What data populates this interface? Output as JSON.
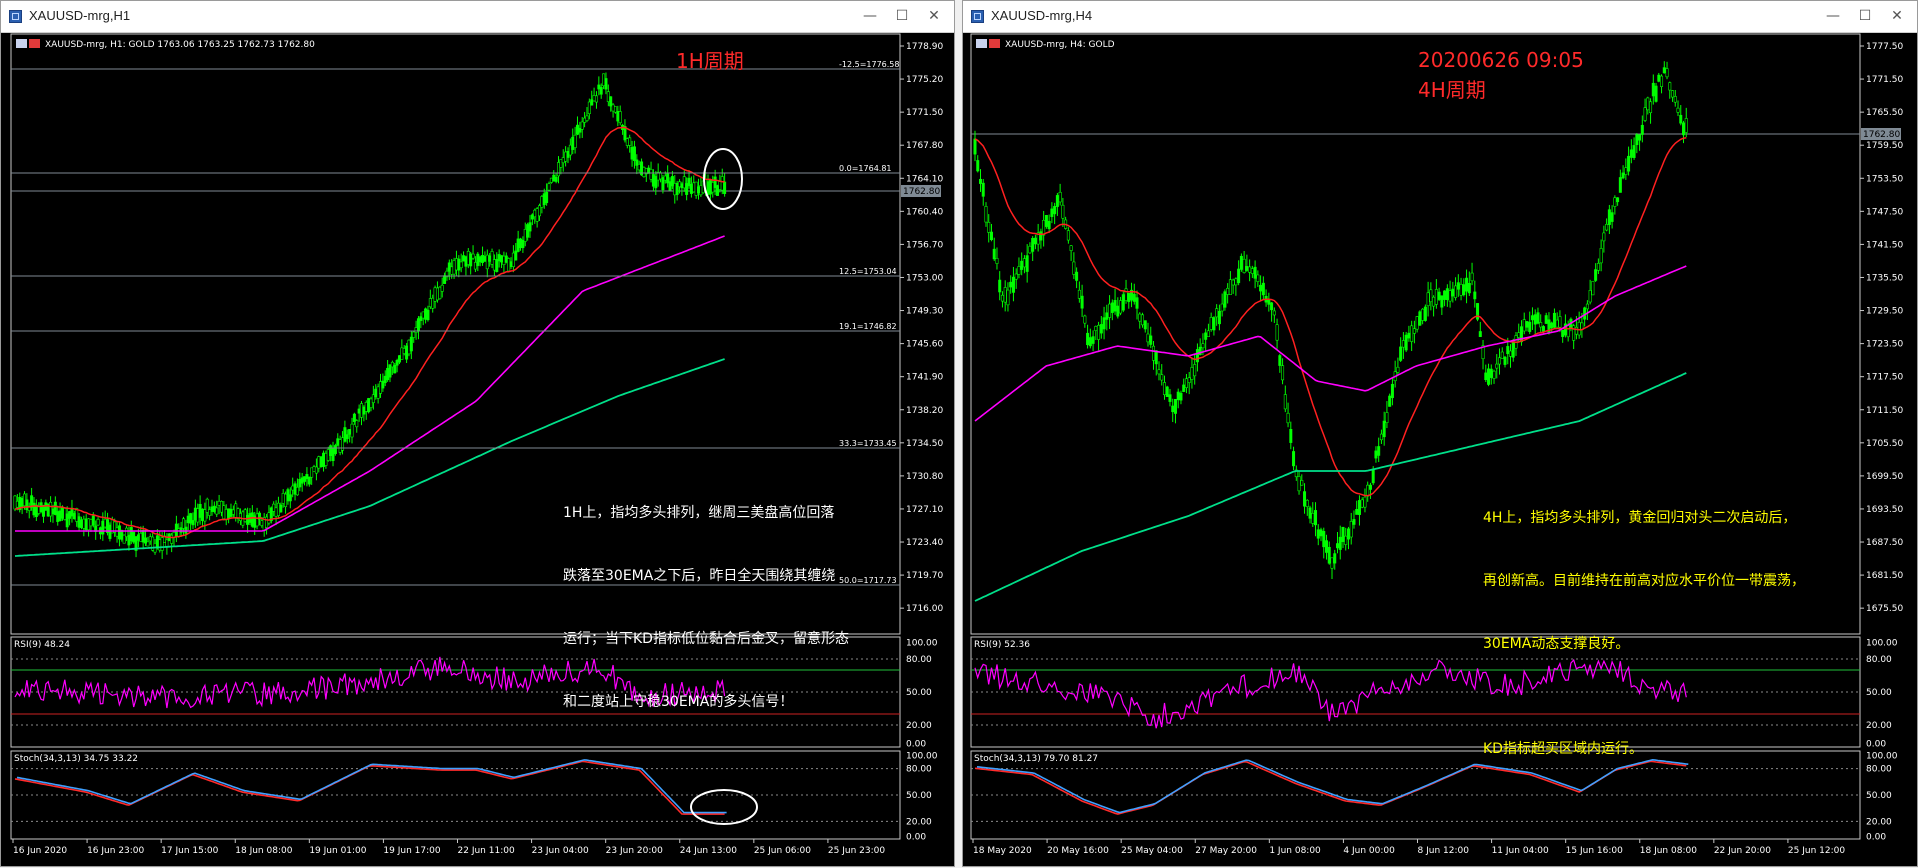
{
  "colors": {
    "candle": "#00ff00",
    "ema_fast": "#ff2020",
    "ema_mid": "#ff00ff",
    "ema_slow": "#00e08a",
    "rsi": "#ff00ff",
    "stoch_main": "#3fa0ff",
    "stoch_signal": "#ff2a2a",
    "hline": "#7f8a94",
    "note_white": "#ffffff",
    "note_yellow": "#ffff00",
    "title_red": "#ff2a2a"
  },
  "left": {
    "window_title": "XAUUSD-mrg,H1",
    "controls": [
      "—",
      "☐",
      "✕"
    ],
    "header": "XAUUSD-mrg, H1:  GOLD  1763.06  1763.25  1762.73  1762.80",
    "big_label": "1H周期",
    "price_ticks": [
      "1778.90",
      "1775.20",
      "1771.50",
      "1767.80",
      "1764.10",
      "1760.40",
      "1756.70",
      "1753.00",
      "1749.30",
      "1745.60",
      "1741.90",
      "1738.20",
      "1734.50",
      "1730.80",
      "1727.10",
      "1723.40",
      "1719.70",
      "1716.00"
    ],
    "current_price": "1762.80",
    "fib_labels": [
      "-12.5=1776.58",
      "0.0=1764.81",
      "12.5=1753.04",
      "19.1=1746.82",
      "33.3=1733.45",
      "50.0=1717.73"
    ],
    "rsi_header": "RSI(9) 48.24",
    "rsi_ticks": [
      "100.00",
      "80.00",
      "50.00",
      "20.00",
      "0.00"
    ],
    "stoch_header": "Stoch(34,3,13) 34.75 33.22",
    "stoch_ticks": [
      "100.00",
      "80.00",
      "50.00",
      "20.00",
      "0.00"
    ],
    "time_labels": [
      "16 Jun 2020",
      "16 Jun 23:00",
      "17 Jun 15:00",
      "18 Jun 08:00",
      "19 Jun 01:00",
      "19 Jun 17:00",
      "22 Jun 11:00",
      "23 Jun 04:00",
      "23 Jun 20:00",
      "24 Jun 13:00",
      "25 Jun 06:00",
      "25 Jun 23:00"
    ],
    "note_lines": [
      "1H上，指均多头排列，继周三美盘高位回落",
      "跌落至30EMA之下后，昨日全天围绕其缠绕",
      "运行；当下KD指标低位黏合后金叉，留意形态",
      "和二度站上守稳30EMA的多头信号！"
    ]
  },
  "right": {
    "window_title": "XAUUSD-mrg,H4",
    "controls": [
      "—",
      "☐",
      "✕"
    ],
    "header": "XAUUSD-mrg, H4:  GOLD",
    "big_label_1": "20200626 09:05",
    "big_label_2": "4H周期",
    "price_ticks": [
      "1777.50",
      "1771.50",
      "1765.50",
      "1759.50",
      "1753.50",
      "1747.50",
      "1741.50",
      "1735.50",
      "1729.50",
      "1723.50",
      "1717.50",
      "1711.50",
      "1705.50",
      "1699.50",
      "1693.50",
      "1687.50",
      "1681.50",
      "1675.50"
    ],
    "current_price": "1762.80",
    "rsi_header": "RSI(9) 52.36",
    "rsi_ticks": [
      "100.00",
      "80.00",
      "50.00",
      "20.00",
      "0.00"
    ],
    "stoch_header": "Stoch(34,3,13) 79.70 81.27",
    "stoch_ticks": [
      "100.00",
      "80.00",
      "50.00",
      "20.00",
      "0.00"
    ],
    "time_labels": [
      "18 May 2020",
      "20 May 16:00",
      "25 May 04:00",
      "27 May 20:00",
      "1 Jun 08:00",
      "4 Jun 00:00",
      "8 Jun 12:00",
      "11 Jun 04:00",
      "15 Jun 16:00",
      "18 Jun 08:00",
      "22 Jun 20:00",
      "25 Jun 12:00"
    ],
    "note_lines": [
      "4H上，指均多头排列，黄金回归对头二次启动后，",
      "再创新高。目前维持在前高对应水平价位一带震荡，",
      "30EMA动态支撑良好。",
      "",
      "KD指标超买区域内运行。"
    ]
  }
}
